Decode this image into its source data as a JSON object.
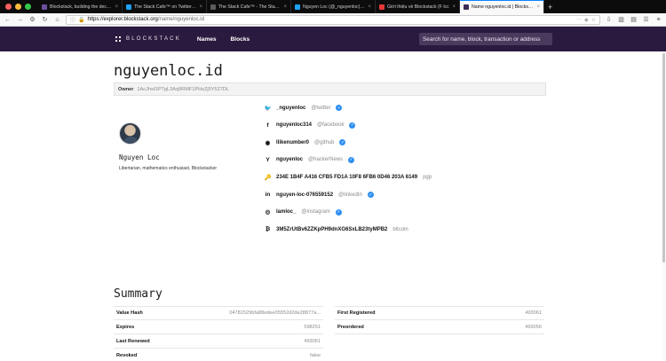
{
  "browser": {
    "tabs": [
      {
        "title": "Blockstack, building the decentr",
        "favicon": "#6b4fa0",
        "active": false
      },
      {
        "title": "The Stack Cafe™ on Twitter: \"@Eric_Weig",
        "favicon": "#1da1f2",
        "active": false
      },
      {
        "title": "The Stack Cafe™ - The Stack Cafe",
        "favicon": "#5b5b5b",
        "active": false
      },
      {
        "title": "Nguyen Loc (@_nguyenloc) | Twitter",
        "favicon": "#1da1f2",
        "active": false
      },
      {
        "title": "Giới thiệu về Blockstack (F lcc",
        "favicon": "#e53935",
        "active": false
      },
      {
        "title": "Name nguyenloc.id | Blockstack Ex",
        "favicon": "#3b2a55",
        "active": true
      }
    ],
    "new_tab": "+",
    "url_host": "https://explorer.blockstack.org",
    "url_path": "/name/nguyenloc.id"
  },
  "header": {
    "logo_text": "BLOCKSTACK",
    "nav": [
      "Names",
      "Blocks"
    ],
    "search_placeholder": "Search for name, block, transaction or address"
  },
  "profile": {
    "name_id": "nguyenloc.id",
    "owner_label": "Owner",
    "owner_address": "1AcJhxiSPTgL3Aq9RMF1PHxZj5Y527DL",
    "display_name": "Nguyen Loc",
    "bio": "Libertarian, mathematics enthusiast, Blockstacker"
  },
  "accounts": [
    {
      "icon": "twitter-icon",
      "glyph": "🐦",
      "identifier": "_nguyenloc",
      "service": "@twitter",
      "verified": true
    },
    {
      "icon": "facebook-icon",
      "glyph": "f",
      "identifier": "nguyenloc314",
      "service": "@facebook",
      "verified": true
    },
    {
      "icon": "github-icon",
      "glyph": "◉",
      "identifier": "llikenumber0",
      "service": "@github",
      "verified": true
    },
    {
      "icon": "hackernews-icon",
      "glyph": "Y",
      "identifier": "nguyenloc",
      "service": "@hackerNews",
      "verified": true
    },
    {
      "icon": "key-icon",
      "glyph": "🔑",
      "identifier": "234E 1B4F A416 CFB5 FD1A 10F8 6FB6 0D46 203A 6149",
      "service": "pgp",
      "verified": false
    },
    {
      "icon": "linkedin-icon",
      "glyph": "in",
      "identifier": "nguyen-loc-076559152",
      "service": "@linkedIn",
      "verified": true
    },
    {
      "icon": "instagram-icon",
      "glyph": "◎",
      "identifier": "lamloc_",
      "service": "@instagram",
      "verified": true
    },
    {
      "icon": "bitcoin-icon",
      "glyph": "₿",
      "identifier": "3M5ZrUtBv6ZZKpPH9dnXG6SxLB23tyMPB2",
      "service": "bitcoin",
      "verified": false
    }
  ],
  "summary": {
    "title": "Summary",
    "left": [
      {
        "key": "Value Hash",
        "value": "04781529bfa88edee05552d2de28877a..."
      },
      {
        "key": "Expires",
        "value": "598251"
      },
      {
        "key": "Last Renewed",
        "value": "493061"
      },
      {
        "key": "Revoked",
        "value": "false"
      }
    ],
    "right": [
      {
        "key": "First Registered",
        "value": "493061"
      },
      {
        "key": "Preordered",
        "value": "493056"
      }
    ]
  },
  "colors": {
    "header_bg": "#2b1a3f",
    "verified": "#2e8ef0"
  }
}
